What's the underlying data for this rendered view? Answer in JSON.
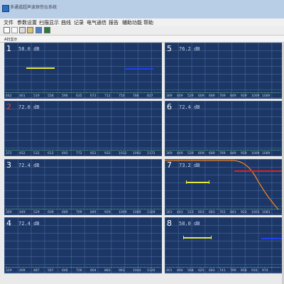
{
  "window": {
    "title": "多通道超声波探伤仪系统"
  },
  "menu": {
    "items": [
      "文件",
      "参数设置",
      "扫描显示",
      "曲线",
      "记录",
      "电气通信",
      "报告",
      "辅助功能",
      "帮助"
    ]
  },
  "toolbar": {
    "icons": [
      "save-icon",
      "open-icon",
      "print-icon",
      "settings-icon",
      "record-icon",
      "info-icon"
    ]
  },
  "status": {
    "label": "A扫显示"
  },
  "colors": {
    "panel_bg": "#1c3766",
    "gate_yellow": "#e8e83a",
    "gate_blue": "#2040f0",
    "gate_red": "#e02020",
    "curve_orange": "#f08020"
  },
  "channels": [
    {
      "num": "1",
      "db": "58.0 dB",
      "ticks": [
        "442",
        "461",
        "519",
        "558",
        "596",
        "635",
        "673",
        "712",
        "750",
        "788",
        "827"
      ]
    },
    {
      "num": "2",
      "db": "72.0 dB",
      "ticks": [
        "372",
        "452",
        "532",
        "612",
        "692",
        "772",
        "852",
        "932",
        "1012",
        "1092",
        "1172"
      ]
    },
    {
      "num": "3",
      "db": "72.4 dB",
      "ticks": [
        "369",
        "449",
        "529",
        "609",
        "689",
        "769",
        "849",
        "929",
        "1009",
        "1089",
        "1169"
      ]
    },
    {
      "num": "4",
      "db": "72.4 dB",
      "ticks": [
        "329",
        "409",
        "487",
        "567",
        "646",
        "726",
        "804",
        "883",
        "963",
        "1044",
        "1120"
      ]
    },
    {
      "num": "5",
      "db": "76.2 dB",
      "ticks": [
        "369",
        "449",
        "529",
        "609",
        "689",
        "769",
        "849",
        "929",
        "1009",
        "1089",
        "1169"
      ]
    },
    {
      "num": "6",
      "db": "72.4 dB",
      "ticks": [
        "369",
        "449",
        "529",
        "609",
        "689",
        "769",
        "849",
        "929",
        "1009",
        "1089",
        "1169"
      ]
    },
    {
      "num": "7",
      "db": "73.2 dB",
      "ticks": [
        "363",
        "443",
        "523",
        "603",
        "683",
        "763",
        "843",
        "923",
        "1003",
        "1083",
        "1163"
      ]
    },
    {
      "num": "8",
      "db": "58.0 dB",
      "ticks": [
        "401",
        "494",
        "568",
        "625",
        "683",
        "741",
        "799",
        "858",
        "916",
        "974",
        "1032"
      ]
    }
  ]
}
